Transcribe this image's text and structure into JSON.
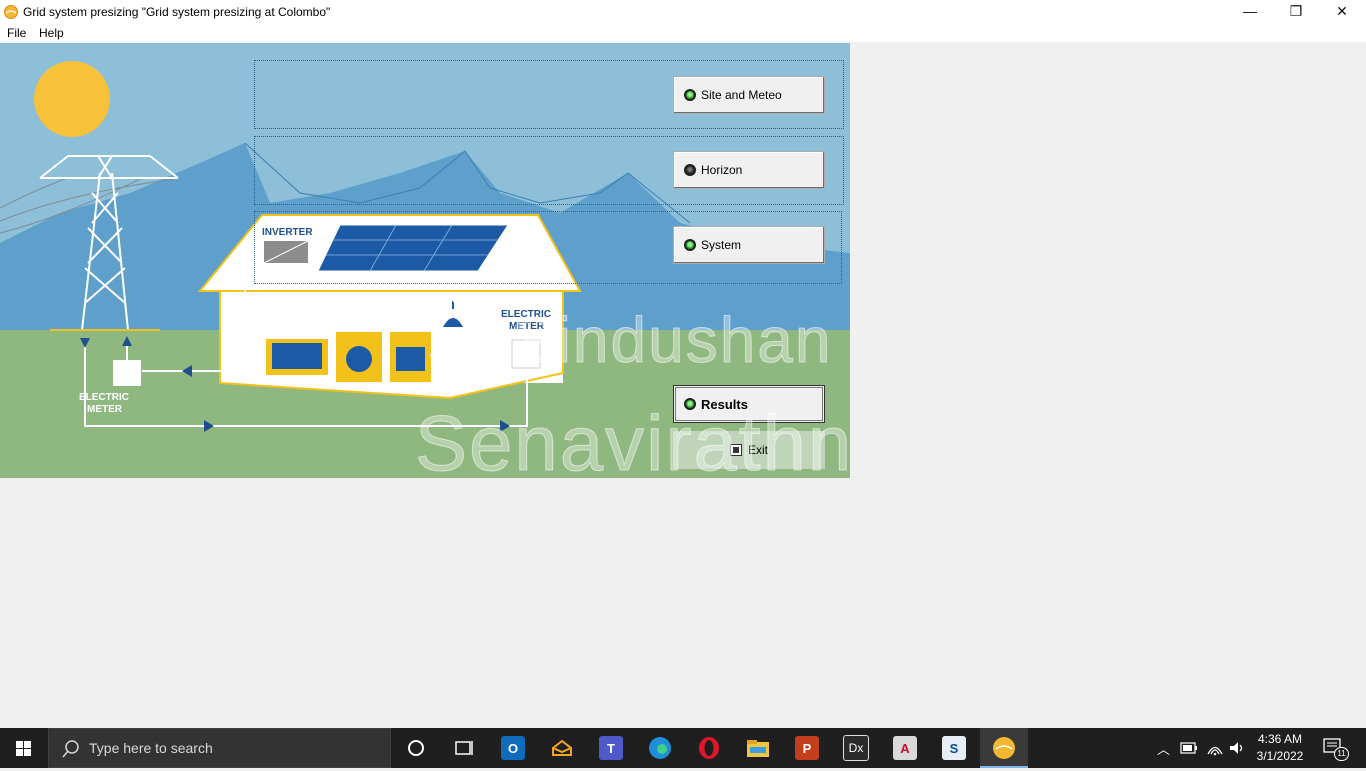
{
  "window": {
    "title": "Grid system presizing  \"Grid system presizing  at Colombo\"",
    "minimize": "—",
    "restore": "❐",
    "close": "✕"
  },
  "menu": {
    "file": "File",
    "help": "Help"
  },
  "scene": {
    "inverter_label": "INVERTER",
    "meter_house_line1": "ELECTRIC",
    "meter_house_line2": "METER",
    "meter_grid_line1": "ELECTRIC",
    "meter_grid_line2": "METER",
    "watermark_line1": "Sindushan",
    "watermark_line2": "Senavirathna"
  },
  "buttons": {
    "site_meteo": "Site and Meteo",
    "horizon": "Horizon",
    "system": "System",
    "results": "Results",
    "exit": "Exit"
  },
  "taskbar": {
    "search_placeholder": "Type here to search",
    "time": "4:36 AM",
    "date": "3/1/2022",
    "notification_count": "11",
    "apps": [
      "cortana-icon",
      "task-view-icon",
      "outlook-icon",
      "mail-icon",
      "teams-icon",
      "edge-icon",
      "opera-icon",
      "file-explorer-icon",
      "powerpoint-icon",
      "dx-icon",
      "autocad-icon",
      "sketchup-icon",
      "pvsyst-icon"
    ]
  },
  "colors": {
    "sky": "#8dbfd9",
    "mountains": "#5e9fcc",
    "grass": "#8fb880",
    "sun": "#f7c23a",
    "accent_yellow": "#f2c21b",
    "dark_blue": "#1f4f8f"
  }
}
